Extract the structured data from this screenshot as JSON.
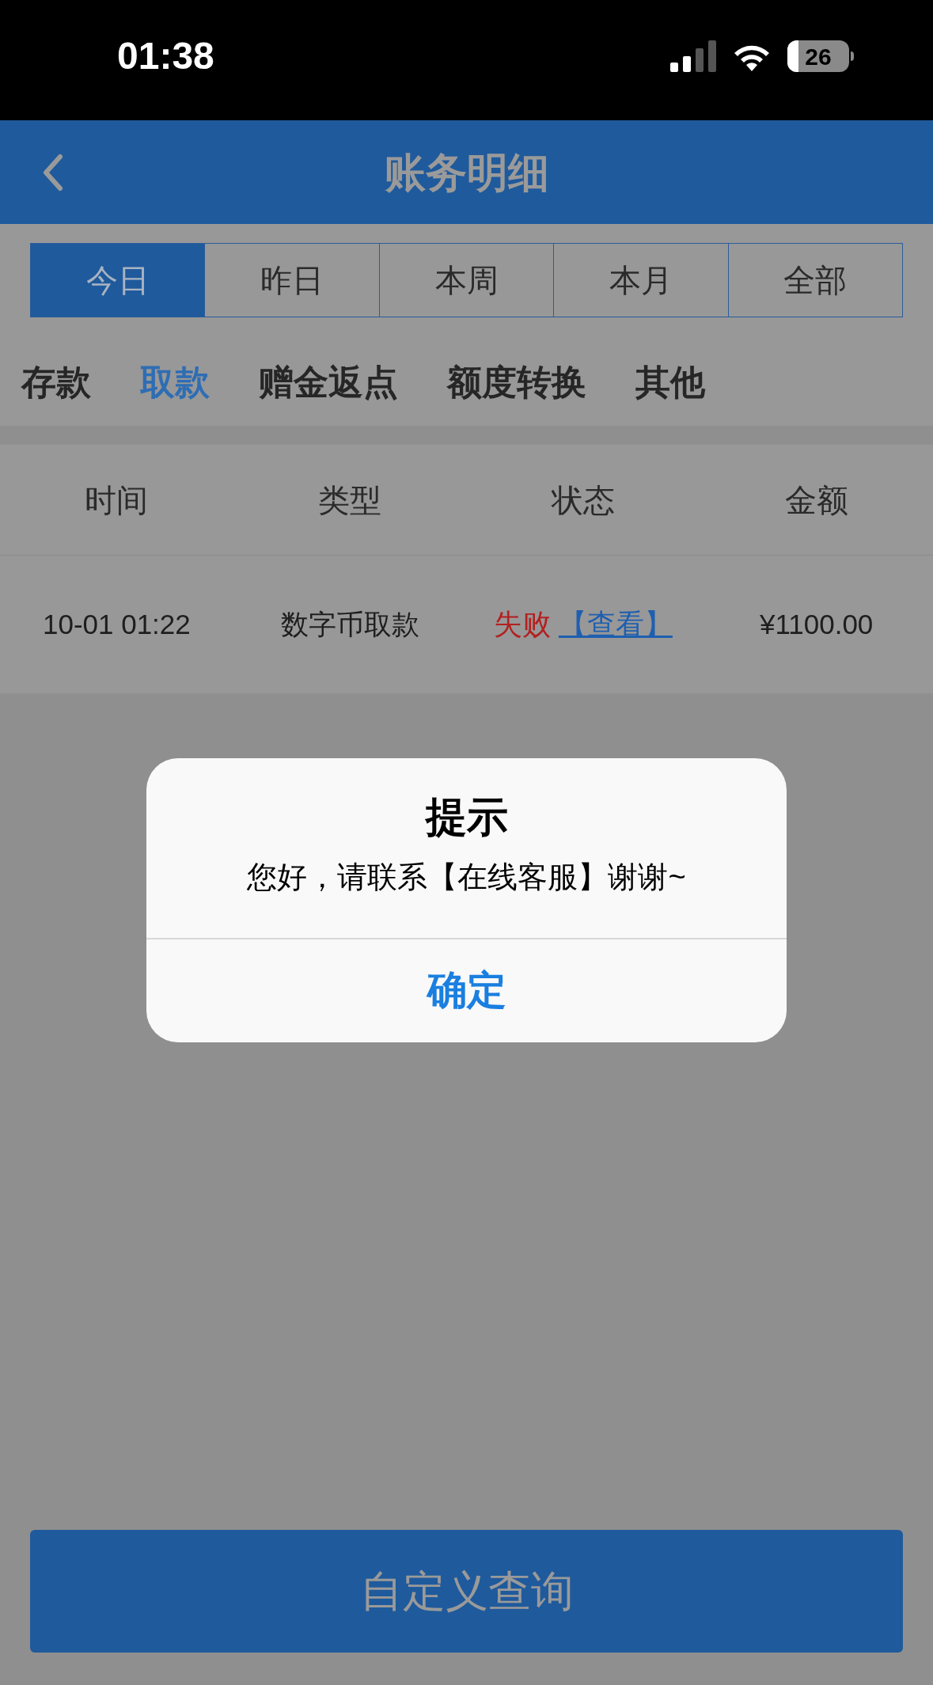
{
  "status_bar": {
    "time": "01:38",
    "battery": "26"
  },
  "header": {
    "title": "账务明细"
  },
  "periods": [
    {
      "label": "今日",
      "selected": true
    },
    {
      "label": "昨日",
      "selected": false
    },
    {
      "label": "本周",
      "selected": false
    },
    {
      "label": "本月",
      "selected": false
    },
    {
      "label": "全部",
      "selected": false
    }
  ],
  "categories": [
    {
      "label": "存款",
      "selected": false
    },
    {
      "label": "取款",
      "selected": true
    },
    {
      "label": "赠金返点",
      "selected": false
    },
    {
      "label": "额度转换",
      "selected": false
    },
    {
      "label": "其他",
      "selected": false
    }
  ],
  "table": {
    "columns": [
      "时间",
      "类型",
      "状态",
      "金额"
    ],
    "rows": [
      {
        "time": "10-01 01:22",
        "type": "数字币取款",
        "status": "失败",
        "failed": true,
        "link": "【查看】",
        "amount": "¥1100.00"
      }
    ]
  },
  "dialog": {
    "title": "提示",
    "message": "您好，请联系【在线客服】谢谢~",
    "button": "确定"
  },
  "custom_query_button": "自定义查询"
}
